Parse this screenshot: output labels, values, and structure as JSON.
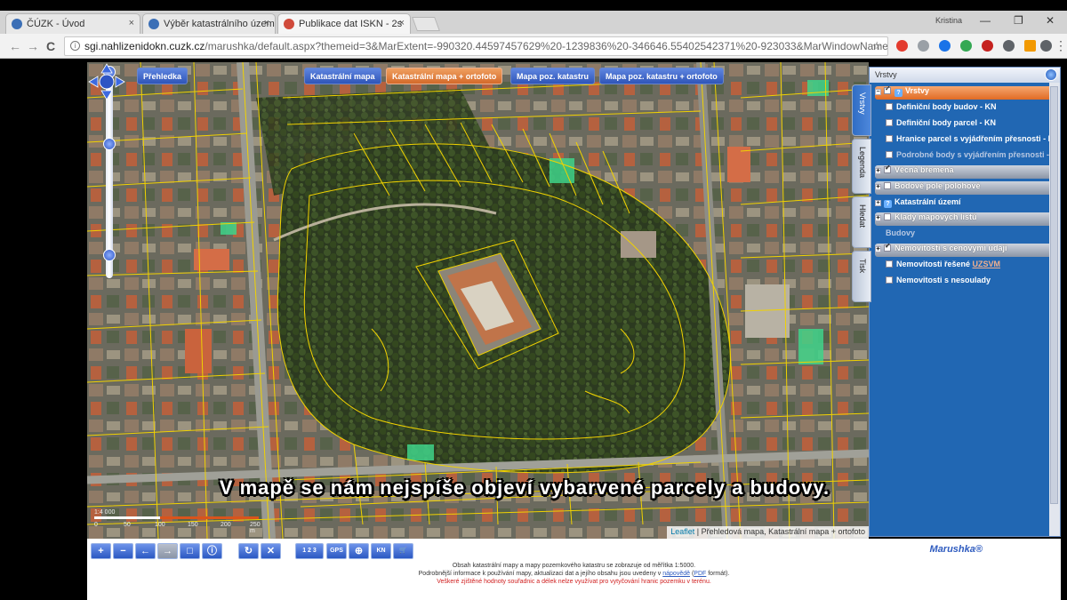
{
  "browser": {
    "tabs": [
      {
        "title": "ČÚZK - Úvod"
      },
      {
        "title": "Výběr katastrálního územ"
      },
      {
        "title": "Publikace dat ISKN - 2s"
      }
    ],
    "tab_close": "×",
    "user": "Kristina",
    "window_min": "—",
    "window_max": "❐",
    "window_close": "✕",
    "url_domain": "sgi.nahlizenidokn.cuzk.cz",
    "url_rest": "/marushka/default.aspx?themeid=3&MarExtent=-990320.44597457629%20-1239836%20-346646.55402542371%20-923033&MarWindowName=Marushka",
    "back_glyph": "←",
    "forward_glyph": "→",
    "reload_glyph": "C",
    "star_glyph": "☆",
    "menu_glyph": "⋮",
    "info_glyph": "i",
    "extension_colors": [
      "#e33b2e",
      "#9aa0a6",
      "#1a73e8",
      "#34a853",
      "#c5221f",
      "#5f6368",
      "#f29900",
      "#5f6368"
    ]
  },
  "map": {
    "top_buttons": [
      {
        "label": "Přehledka",
        "style": "blue"
      },
      {
        "label": "Katastrální mapa",
        "style": "blue"
      },
      {
        "label": "Katastrální mapa + ortofoto",
        "style": "orange"
      },
      {
        "label": "Mapa poz. katastru",
        "style": "blue"
      },
      {
        "label": "Mapa poz. katastru + ortofoto",
        "style": "blue"
      }
    ],
    "attribution_link": "Leaflet",
    "attribution_text": " | Přehledová mapa, Katastrální mapa + ortofoto",
    "scale_label": "1:4 000",
    "scale_ticks": [
      "0",
      "50",
      "100",
      "150",
      "200",
      "250 m"
    ],
    "zoom_in": "+",
    "zoom_out": "−"
  },
  "subtitle": "V mapě se nám nejspíše objeví vybarvené parcely a budovy.",
  "panel": {
    "title": "Vrstvy",
    "side_tabs": [
      "Vrstvy",
      "Legenda",
      "Hledat",
      "Tisk"
    ],
    "layers": [
      {
        "label": "Vrstvy",
        "kind": "root",
        "checked": true
      },
      {
        "label": "Definiční body budov - KN",
        "kind": "item",
        "checked": false
      },
      {
        "label": "Definiční body parcel - KN",
        "kind": "item",
        "checked": false
      },
      {
        "label": "Hranice parcel s vyjádřením přesnosti - KN",
        "kind": "item",
        "checked": false
      },
      {
        "label": "Podrobné body s vyjádřením přesnosti - KN",
        "kind": "dim",
        "checked": false
      },
      {
        "label": "Věcná břemena",
        "kind": "grp",
        "checked": true
      },
      {
        "label": "Bodové pole polohové",
        "kind": "grp",
        "checked": false
      },
      {
        "label": "Katastrální území",
        "kind": "item-q",
        "checked": false
      },
      {
        "label": "Klady mapových listů",
        "kind": "grp",
        "checked": false
      },
      {
        "label": "Budovy",
        "kind": "dim-plain",
        "checked": false
      },
      {
        "label": "Nemovitosti s cenovými údaji",
        "kind": "grp",
        "checked": true
      },
      {
        "label": "Nemovitosti řešené ",
        "link": "UZSVM",
        "kind": "item-link",
        "checked": false
      },
      {
        "label": "Nemovitosti s nesoulady",
        "kind": "item",
        "checked": false
      }
    ]
  },
  "bottom": {
    "tool_buttons": [
      "+",
      "−",
      "←",
      "→",
      "□",
      "ⓘ",
      "↻",
      "✕",
      "1 2 3",
      "GPS",
      "⊕",
      "KN",
      "🛒"
    ],
    "logo": "Marushka®",
    "info_line1": "Obsah katastrální mapy a mapy pozemkového katastru se zobrazuje od měřítka 1:5000.",
    "info_line2_pre": "Podrobnější informace k používání mapy, aktualizaci dat a jejího obsahu jsou uvedeny v",
    "info_line2_link": "nápovědě",
    "info_line2_mid": " (",
    "info_line2_link2": "PDF",
    "info_line2_post": " formát).",
    "info_line3": "Veškeré zjištěné hodnoty souřadnic a délek nelze využívat pro vytyčování hranic pozemku v terénu."
  }
}
